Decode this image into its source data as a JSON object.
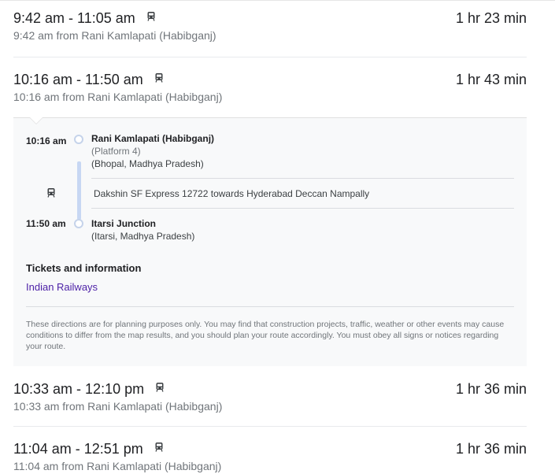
{
  "trips": [
    {
      "time_range": "9:42 am - 11:05 am",
      "duration": "1 hr 23 min",
      "departure": "9:42 am from Rani Kamlapati (Habibganj)",
      "icon": "train-icon"
    },
    {
      "time_range": "10:16 am - 11:50 am",
      "duration": "1 hr 43 min",
      "departure": "10:16 am from Rani Kamlapati (Habibganj)",
      "icon": "train-icon",
      "expanded": true
    },
    {
      "time_range": "10:33 am - 12:10 pm",
      "duration": "1 hr 36 min",
      "departure": "10:33 am from Rani Kamlapati (Habibganj)",
      "icon": "train-icon"
    },
    {
      "time_range": "11:04 am - 12:51 pm",
      "duration": "1 hr 36 min",
      "departure": "11:04 am from Rani Kamlapati (Habibganj)",
      "icon": "train-icon"
    }
  ],
  "details": {
    "origin": {
      "time": "10:16 am",
      "name": "Rani Kamlapati (Habibganj)",
      "platform": "(Platform 4)",
      "region": "(Bhopal, Madhya Pradesh)"
    },
    "service": "Dakshin SF Express 12722 towards Hyderabad Deccan Nampally",
    "destination": {
      "time": "11:50 am",
      "name": "Itarsi Junction",
      "region": "(Itarsi, Madhya Pradesh)"
    },
    "tickets_heading": "Tickets and information",
    "ticket_link": "Indian Railways",
    "disclaimer": "These directions are for planning purposes only. You may find that construction projects, traffic, weather or other events may cause conditions to differ from the map results, and you should plan your route accordingly. You must obey all signs or notices regarding your route."
  },
  "colors": {
    "route_line": "#c7d7f3",
    "link": "#4b1fa6",
    "panel_bg": "#f8f9fa"
  }
}
